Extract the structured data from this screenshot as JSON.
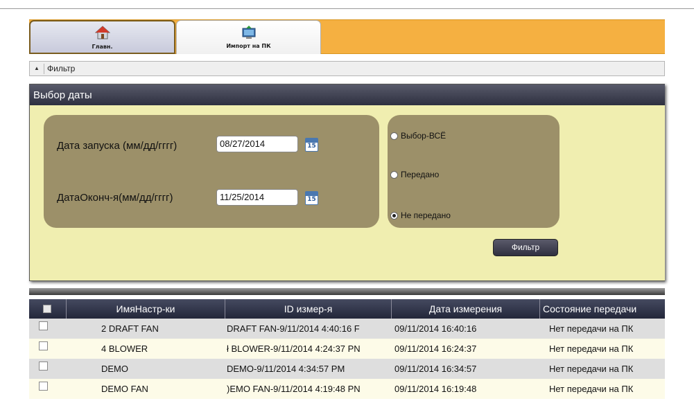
{
  "tabs": [
    {
      "label": "Главн.",
      "icon": "home-icon",
      "active": true
    },
    {
      "label": "Импорт на ПК",
      "icon": "computer-import-icon",
      "active": false
    }
  ],
  "filter": {
    "toggle_icon": "▲",
    "header_label": "Фильтр",
    "panel_title": "Выбор даты",
    "start_label": "Дата запуска (мм/дд/гггг)",
    "start_value": "08/27/2014",
    "end_label": "ДатаОконч-я(мм/дд/гггг)",
    "end_value": "11/25/2014",
    "calendar_day": "15",
    "radios": [
      {
        "label": "Выбор-ВСЁ",
        "checked": false
      },
      {
        "label": "Передано",
        "checked": false
      },
      {
        "label": "Не передано",
        "checked": true
      }
    ],
    "button_label": "Фильтр"
  },
  "table": {
    "columns": [
      "ИмяНастр-ки",
      "ID измер-я",
      "Дата измерения",
      "Состояние передачи"
    ],
    "rows": [
      {
        "name": "2 DRAFT FAN",
        "id": "DRAFT FAN-9/11/2014 4:40:16 F",
        "date": "09/11/2014 16:40:16",
        "status": "Нет передачи на ПК"
      },
      {
        "name": "4 BLOWER",
        "id": "ł BLOWER-9/11/2014 4:24:37 PN",
        "date": "09/11/2014 16:24:37",
        "status": "Нет передачи на ПК"
      },
      {
        "name": "DEMO",
        "id": "DEMO-9/11/2014 4:34:57 PM",
        "date": "09/11/2014 16:34:57",
        "status": "Нет передачи на ПК"
      },
      {
        "name": "DEMO FAN",
        "id": ")EMO FAN-9/11/2014 4:19:48 PN",
        "date": "09/11/2014 16:19:48",
        "status": "Нет передачи на ПК"
      }
    ]
  },
  "colors": {
    "tab_bar": "#f5b041",
    "panel_background": "#f0eeb0",
    "group_box": "#9c9069",
    "header_dark": "#2e3040",
    "row_odd": "#dedede",
    "row_even": "#fdfbe8"
  }
}
